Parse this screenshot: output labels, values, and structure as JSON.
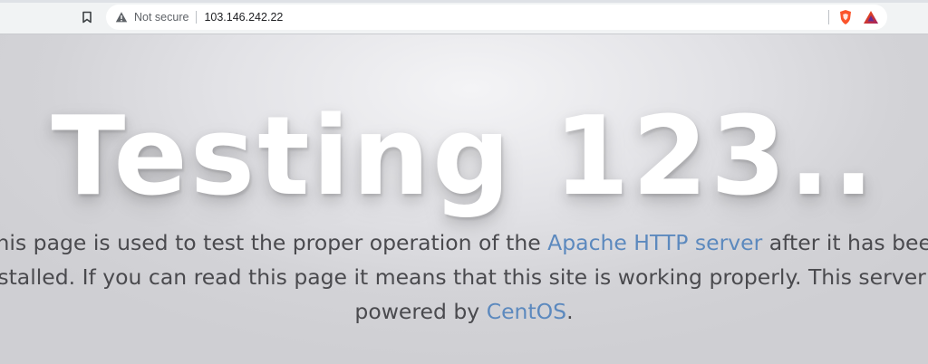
{
  "browser": {
    "security_label": "Not secure",
    "url": "103.146.242.22",
    "icons": {
      "bookmark": "bookmark-icon",
      "warning": "warning-icon",
      "brave_shield": "brave-shield-icon",
      "brave_rewards": "brave-rewards-icon"
    }
  },
  "page": {
    "title": "Testing 123..",
    "lead": {
      "line1_pre": "This page is used to test the proper operation of the ",
      "line1_link": "Apache HTTP server",
      "line1_post": " after it has been",
      "line2": "installed. If you can read this page it means that this site is working properly. This server is",
      "line3_pre": "powered by ",
      "line3_link": "CentOS",
      "line3_post": "."
    },
    "colors": {
      "link": "#5c89be",
      "text": "#4a4a4e",
      "title": "#ffffff"
    }
  }
}
